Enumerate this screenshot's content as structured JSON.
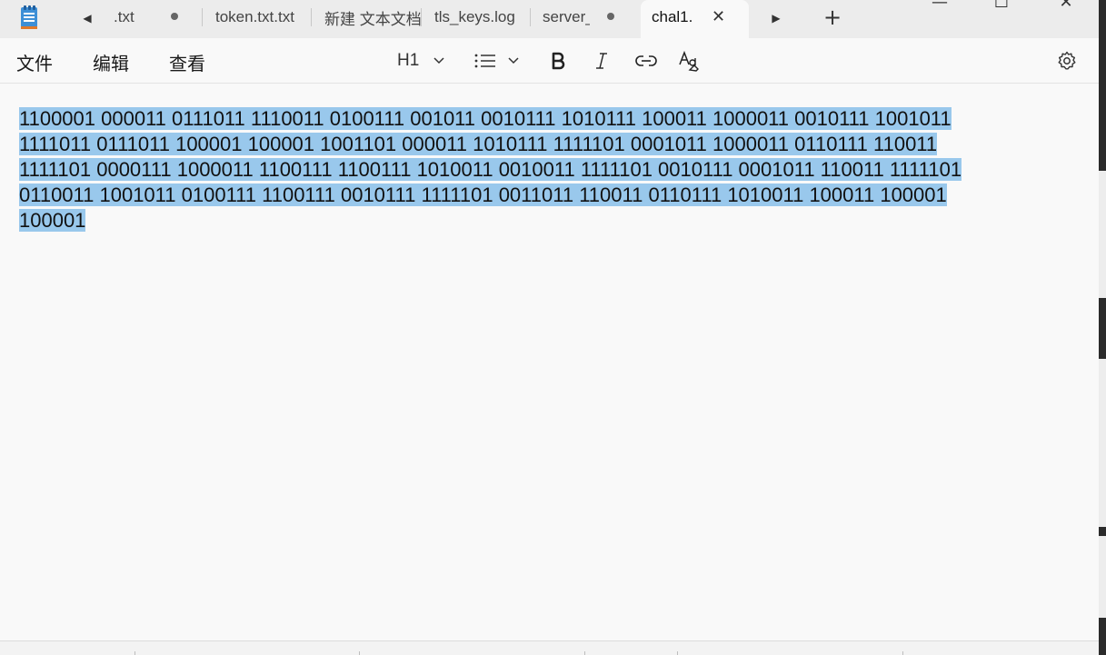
{
  "titlebar": {
    "tabs": [
      {
        "label": ".txt",
        "modified": true
      },
      {
        "label": "token.txt.txt",
        "modified": false
      },
      {
        "label": "新建 文本文档",
        "modified": false
      },
      {
        "label": "tls_keys.log",
        "modified": false
      },
      {
        "label": "server_",
        "modified": true
      }
    ],
    "active_tab": {
      "label": "chal1.",
      "close_symbol": "✕"
    },
    "add_tab_symbol": "+",
    "window_controls": {
      "minimize": "—",
      "maximize": "☐",
      "close": "✕"
    }
  },
  "menu": {
    "file": "文件",
    "edit": "编辑",
    "view": "查看"
  },
  "toolbar": {
    "heading_level": "H1",
    "icons": [
      "heading-dropdown",
      "list-icon",
      "bold-icon",
      "italic-icon",
      "link-icon",
      "clear-formatting-icon",
      "gear-icon"
    ]
  },
  "editor": {
    "content": "1100001 000011 0111011 1110011 0100111 001011 0010111 1010111 100011 1000011 0010111 1001011 1111011 0111011 100001 100001 1001101 000011 1010111 1111101 0001011 1000011 0110111 110011 1111101 0000111 1000011 1100111 1100111 1010011 0010011 1111101 0010111 0001011 110011 1111101 0110011 1001011 0100111 1100111 0010111 1111101 0011011 110011 0110111 1010011 100011 100001 100001",
    "lines": [
      "1100001 000011 0111011 1110011 0100111 001011 0010111 1010111 100011 1000011 0010111 1001011",
      "1111011 0111011 100001 100001 1001101 000011 1010111 1111101 0001011 1000011 0110111 110011",
      "1111101 0000111 1000011 1100111 1100111 1010011 0010011 1111101 0010111 0001011 110011 1111101",
      "0110011 1001011 0100111 1100111 0010111 1111101 0011011 110011 0110111 1010011 100011 100001",
      "100001"
    ]
  },
  "colors": {
    "selection": "#99c8ec",
    "app_background": "#f9f9f9",
    "tabbar": "#ececec",
    "app_icon": "#3d8fd6"
  }
}
